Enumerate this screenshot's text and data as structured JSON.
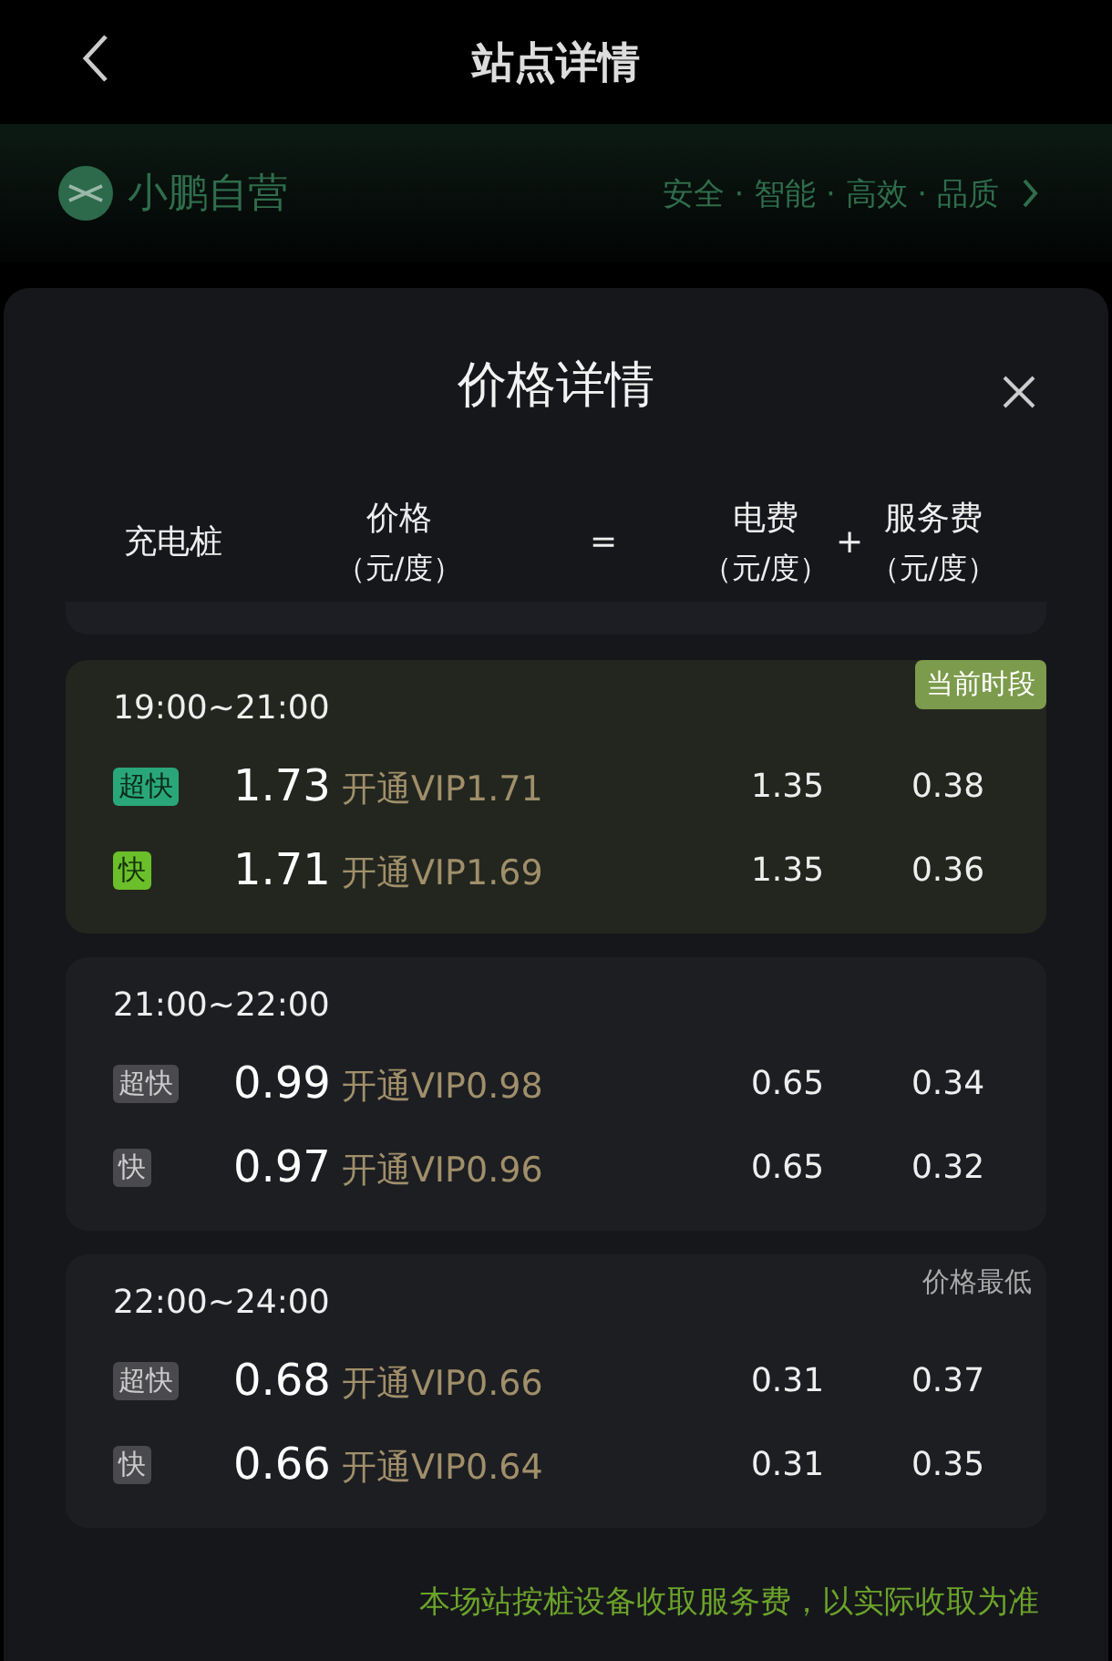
{
  "header": {
    "title": "站点详情"
  },
  "banner": {
    "brand": "小鹏自营",
    "slogan": "安全 · 智能 · 高效 · 品质"
  },
  "sheet": {
    "title": "价格详情",
    "columns": [
      {
        "kind": "text",
        "label": "充电桩"
      },
      {
        "kind": "text",
        "label": "价格",
        "unit": "（元/度）"
      },
      {
        "kind": "op",
        "label": "="
      },
      {
        "kind": "text",
        "label": "电费",
        "unit": "（元/度）"
      },
      {
        "kind": "op",
        "label": "+"
      },
      {
        "kind": "text",
        "label": "服务费",
        "unit": "（元/度）"
      }
    ],
    "periods": [
      {
        "time": "19:00~21:00",
        "current": true,
        "tag": {
          "kind": "current",
          "label": "当前时段"
        },
        "rows": [
          {
            "kind": "superfast",
            "type": "超快",
            "price": "1.73",
            "vip": "开通VIP1.71",
            "electricity": "1.35",
            "service": "0.38"
          },
          {
            "kind": "fast",
            "type": "快",
            "price": "1.71",
            "vip": "开通VIP1.69",
            "electricity": "1.35",
            "service": "0.36"
          }
        ]
      },
      {
        "time": "21:00~22:00",
        "current": false,
        "rows": [
          {
            "kind": "superfast",
            "type": "超快",
            "price": "0.99",
            "vip": "开通VIP0.98",
            "electricity": "0.65",
            "service": "0.34"
          },
          {
            "kind": "fast",
            "type": "快",
            "price": "0.97",
            "vip": "开通VIP0.96",
            "electricity": "0.65",
            "service": "0.32"
          }
        ]
      },
      {
        "time": "22:00~24:00",
        "current": false,
        "tag": {
          "kind": "lowest",
          "label": "价格最低"
        },
        "rows": [
          {
            "kind": "superfast",
            "type": "超快",
            "price": "0.68",
            "vip": "开通VIP0.66",
            "electricity": "0.31",
            "service": "0.37"
          },
          {
            "kind": "fast",
            "type": "快",
            "price": "0.66",
            "vip": "开通VIP0.64",
            "electricity": "0.31",
            "service": "0.35"
          }
        ]
      }
    ],
    "note": "本场站按桩设备收取服务费，以实际收取为准"
  }
}
